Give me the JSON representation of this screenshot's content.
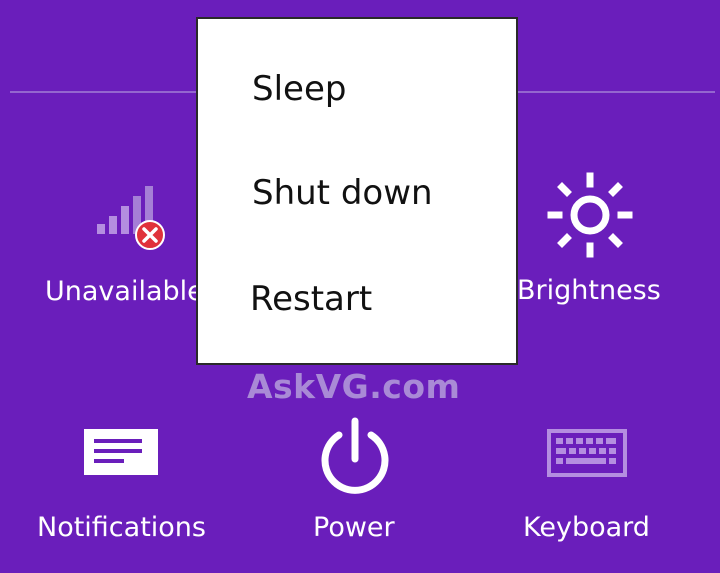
{
  "power_menu": {
    "items": [
      {
        "label": "Sleep"
      },
      {
        "label": "Shut down"
      },
      {
        "label": "Restart"
      }
    ]
  },
  "settings": {
    "network": {
      "label": "Unavailable",
      "icon": "network-unavailable-icon"
    },
    "brightness": {
      "label": "Brightness",
      "icon": "brightness-icon"
    },
    "notifications": {
      "label": "Notifications",
      "icon": "notifications-icon"
    },
    "power": {
      "label": "Power",
      "icon": "power-icon"
    },
    "keyboard": {
      "label": "Keyboard",
      "icon": "keyboard-icon"
    }
  },
  "watermark": "AskVG.com",
  "colors": {
    "background": "#6a1ebb",
    "divider": "#9466cf",
    "menu_background": "#ffffff",
    "error_badge": "#e0323b"
  }
}
